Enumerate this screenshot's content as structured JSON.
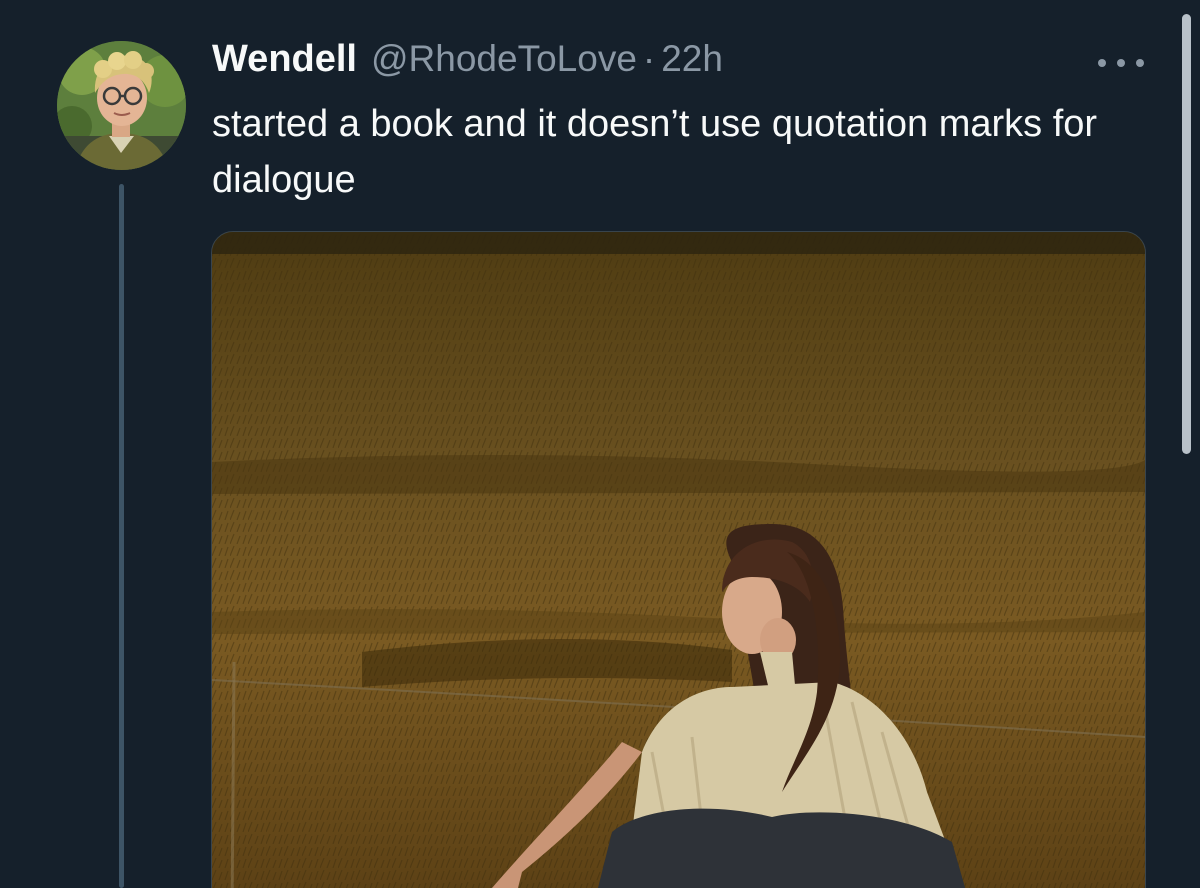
{
  "tweet": {
    "author_name": "Wendell",
    "handle": "@RhodeToLove",
    "separator": "·",
    "time": "22h",
    "text": "started a book and it doesn’t use quotation marks for dialogue"
  },
  "icons": {
    "more": "more-horizontal-icon"
  },
  "colors": {
    "background": "#15202b",
    "primary_text": "#f7f9f9",
    "secondary_text": "#8b98a5",
    "thread_line": "#3d5466"
  }
}
